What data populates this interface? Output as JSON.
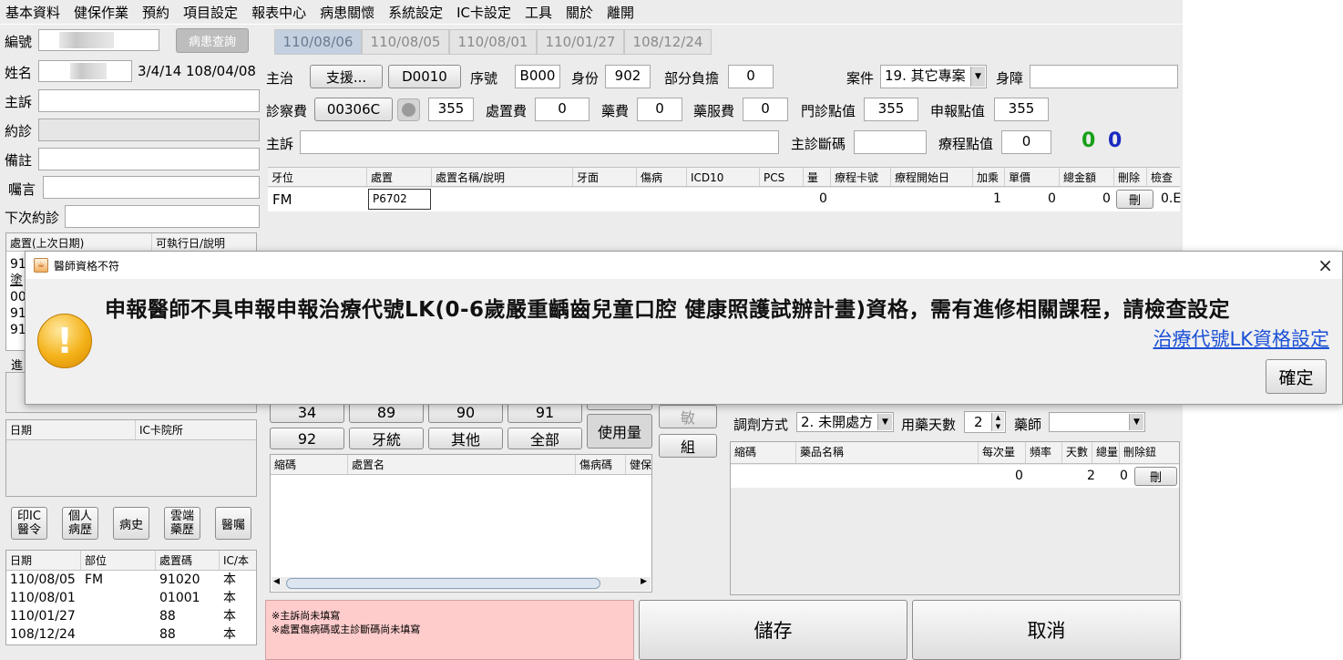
{
  "menu": [
    "基本資料",
    "健保作業",
    "預約",
    "項目設定",
    "報表中心",
    "病患關懷",
    "系統設定",
    "IC卡設定",
    "工具",
    "關於",
    "離開"
  ],
  "left": {
    "id_label": "編號",
    "patient_query": "病患查詢",
    "name_label": "姓名",
    "birth": "3/4/14",
    "visit_date": "108/04/08",
    "complaint_label": "主訴",
    "appointment_label": "約診",
    "note_label": "備註",
    "instruction_label": "囑言",
    "next_appt_label": "下次約診",
    "treat_table": {
      "headers": [
        "處置(上次日期)",
        "可執行日/說明"
      ],
      "rows_partial": [
        "91",
        "塗",
        "00",
        "91",
        "91"
      ]
    },
    "progress_label": "進",
    "ic_table": {
      "headers": [
        "日期",
        "IC卡院所"
      ]
    },
    "action_buttons": [
      "印IC醫令",
      "個人病歷",
      "病史",
      "雲端藥歷",
      "醫囑"
    ],
    "history_table": {
      "headers": [
        "日期",
        "部位",
        "處置碼",
        "IC/本"
      ],
      "rows": [
        [
          "110/08/05",
          "FM",
          "91020",
          "本"
        ],
        [
          "110/08/01",
          "",
          "01001",
          "本"
        ],
        [
          "110/01/27",
          "",
          "88",
          "本"
        ],
        [
          "108/12/24",
          "",
          "88",
          "本"
        ]
      ]
    }
  },
  "tabs": [
    "110/08/06",
    "110/08/05",
    "110/08/01",
    "110/01/27",
    "108/12/24"
  ],
  "form": {
    "doctor_label": "主治",
    "support_button": "支援...",
    "doctor_code": "D0010",
    "seq_label": "序號",
    "seq_value": "B000",
    "identity_label": "身份",
    "identity_value": "902",
    "copay_label": "部分負擔",
    "copay_value": "0",
    "case_label": "案件",
    "case_value": "19. 其它專案",
    "disability_label": "身障",
    "exam_fee_label": "診察費",
    "exam_fee_code": "00306C",
    "exam_fee_value": "355",
    "treatment_fee_label": "處置費",
    "treatment_fee_value": "0",
    "drug_fee_label": "藥費",
    "drug_fee_value": "0",
    "dispense_fee_label": "藥服費",
    "dispense_fee_value": "0",
    "clinic_points_label": "門診點值",
    "clinic_points_value": "355",
    "claim_points_label": "申報點值",
    "claim_points_value": "355",
    "complaint_label": "主訴",
    "main_diag_label": "主診斷碼",
    "course_points_label": "療程點值",
    "course_points_value": "0",
    "counter_green": "0",
    "counter_blue": "0"
  },
  "treat_grid": {
    "headers": [
      "牙位",
      "處置",
      "處置名稱/說明",
      "牙面",
      "傷病",
      "ICD10",
      "PCS",
      "量",
      "療程卡號",
      "療程開始日",
      "加乘",
      "單價",
      "總金額",
      "刪除",
      "檢查"
    ],
    "row": {
      "tooth": "FM",
      "code": "P6702",
      "qty": "0",
      "mult": "1",
      "price": "0",
      "total": "0",
      "delete": "刪",
      "check": "0.E"
    }
  },
  "dialog": {
    "title": "醫師資格不符",
    "close": "×",
    "icon": "warning-icon",
    "message": "申報醫師不具申報申報治療代號LK(0-6歲嚴重齲齒兒童口腔 健康照護試辦計畫)資格，需有進修相關課程，請檢查設定",
    "link": "治療代號LK資格設定",
    "ok": "確定"
  },
  "numpad": {
    "row1": [
      "34",
      "89",
      "90",
      "91"
    ],
    "row2": [
      "92",
      "牙統",
      "其他",
      "全部"
    ],
    "usage": "使用量",
    "allergy": "敏",
    "group": "組"
  },
  "proc_table": {
    "headers": [
      "縮碼",
      "處置名",
      "傷病碼",
      "健保"
    ]
  },
  "rx": {
    "method_label": "調劑方式",
    "method_value": "2. 未開處方",
    "days_label": "用藥天數",
    "days_value": "2",
    "pharmacist_label": "藥師",
    "headers": [
      "縮碼",
      "藥品名稱",
      "每次量",
      "頻率",
      "天數",
      "總量",
      "刪除鈕"
    ],
    "row": {
      "dose": "0",
      "days": "2",
      "total": "0",
      "delete": "刪"
    }
  },
  "warnings": [
    "※主訴尚未填寫",
    "※處置傷病碼或主診斷碼尚未填寫"
  ],
  "save": "儲存",
  "cancel": "取消"
}
